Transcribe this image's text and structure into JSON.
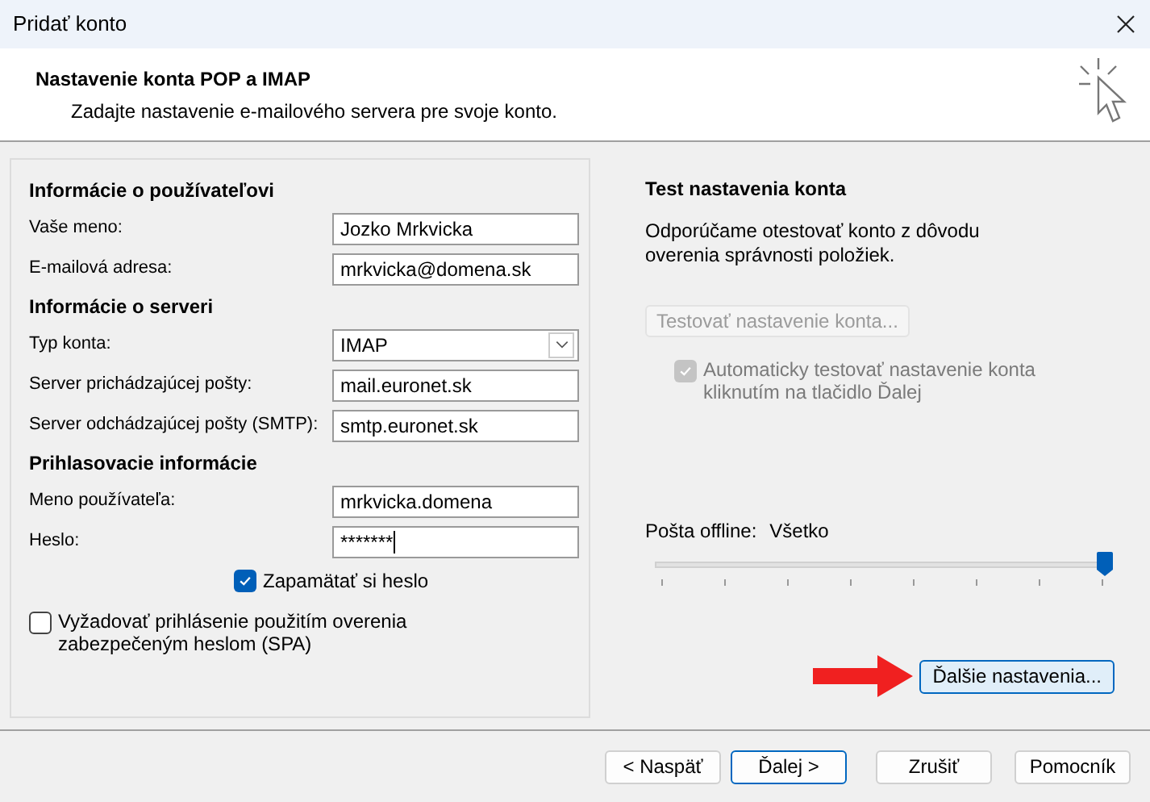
{
  "window": {
    "title": "Pridať konto"
  },
  "header": {
    "title": "Nastavenie konta POP a IMAP",
    "subtitle": "Zadajte nastavenie e-mailového servera pre svoje konto."
  },
  "sections": [
    {
      "title": "Informácie o používateľovi",
      "fields": [
        {
          "kind": "text",
          "label": "Vaše meno:",
          "value": "Jozko Mrkvicka"
        },
        {
          "kind": "text",
          "label": "E-mailová adresa:",
          "value": "mrkvicka@domena.sk"
        }
      ]
    },
    {
      "title": "Informácie o serveri",
      "fields": [
        {
          "kind": "dropdown",
          "label": "Typ konta:",
          "value": "IMAP"
        },
        {
          "kind": "text",
          "label": "Server prichádzajúcej pošty:",
          "value": "mail.euronet.sk"
        },
        {
          "kind": "text",
          "label": "Server odchádzajúcej pošty (SMTP):",
          "value": "smtp.euronet.sk"
        }
      ]
    },
    {
      "title": "Prihlasovacie informácie",
      "fields": [
        {
          "kind": "text",
          "label": "Meno používateľa:",
          "value": "mrkvicka.domena"
        },
        {
          "kind": "password",
          "label": "Heslo:",
          "value": "*******"
        }
      ]
    }
  ],
  "remember_password": {
    "label": "Zapamätať si heslo",
    "checked": true
  },
  "spa": {
    "label": "Vyžadovať prihlásenie použitím overenia zabezpečeným heslom (SPA)",
    "checked": false
  },
  "test": {
    "title": "Test nastavenia konta",
    "description": "Odporúčame otestovať konto z dôvodu overenia správnosti položiek.",
    "button": {
      "label": "Testovať nastavenie konta...",
      "disabled": true
    },
    "auto_test": {
      "label": "Automaticky testovať nastavenie konta kliknutím na tlačidlo Ďalej",
      "checked": true,
      "disabled": true
    }
  },
  "offline": {
    "label": "Pošta offline:",
    "value": "Všetko",
    "level": 1
  },
  "more_settings": {
    "label": "Ďalšie nastavenia..."
  },
  "buttons": [
    {
      "label": "< Naspäť",
      "default": false
    },
    {
      "label": "Ďalej >",
      "default": true
    },
    {
      "label": "Zrušiť",
      "default": false
    },
    {
      "label": "Pomocník",
      "default": false
    }
  ]
}
